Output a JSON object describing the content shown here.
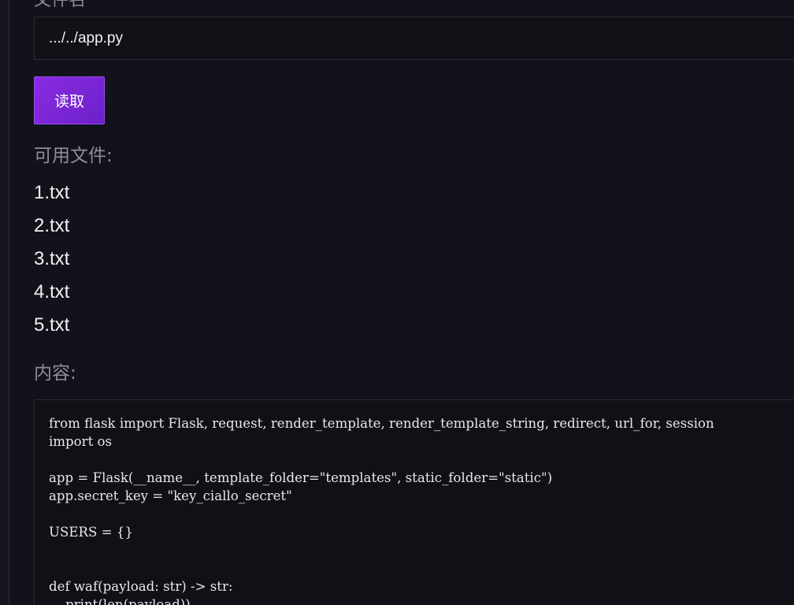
{
  "form": {
    "filename_label": "文件名",
    "filename_value": ".../../app.py",
    "read_button_label": "读取"
  },
  "files": {
    "heading": "可用文件:",
    "items": [
      "1.txt",
      "2.txt",
      "3.txt",
      "4.txt",
      "5.txt"
    ]
  },
  "content": {
    "heading": "内容:",
    "code": "from flask import Flask, request, render_template, render_template_string, redirect, url_for, session\nimport os\n\napp = Flask(__name__, template_folder=\"templates\", static_folder=\"static\")\napp.secret_key = \"key_ciallo_secret\"\n\nUSERS = {}\n\n\ndef waf(payload: str) -> str:\n    print(len(payload))"
  },
  "colors": {
    "background": "#12121a",
    "accent": "#8a2be2",
    "muted_text": "#8e8e98"
  }
}
